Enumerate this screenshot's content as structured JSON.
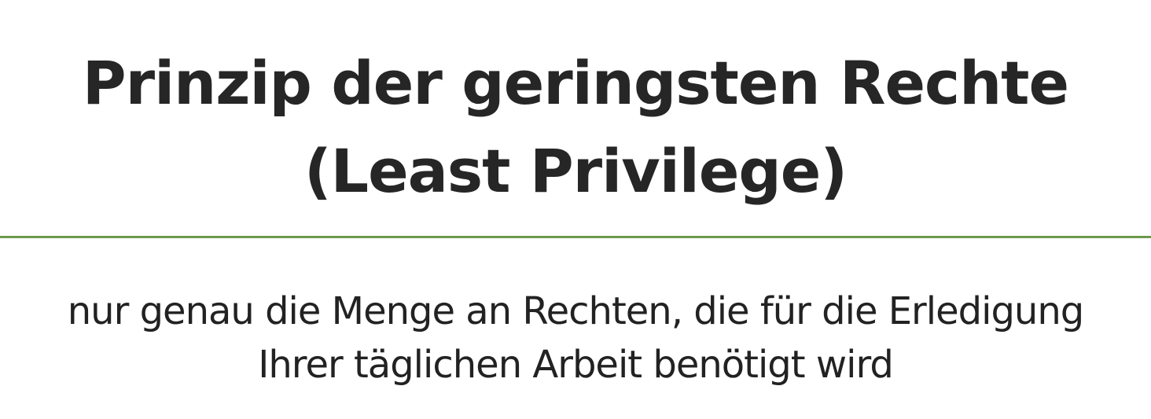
{
  "title": {
    "line1": "Prinzip der geringsten Rechte",
    "line2": "(Least Privilege)"
  },
  "description": {
    "line1": "nur genau die Menge an Rechten, die für die Erledigung",
    "line2": "Ihrer täglichen Arbeit benötigt wird"
  },
  "colors": {
    "text": "#222222",
    "divider": "#6a9a4a",
    "background": "#ffffff"
  }
}
